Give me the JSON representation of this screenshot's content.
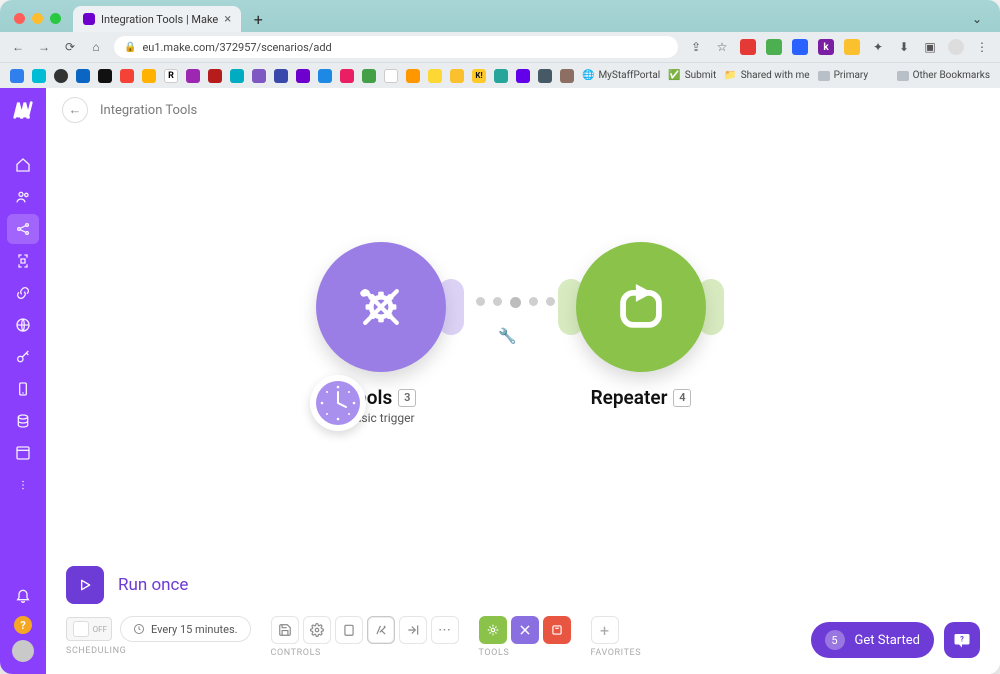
{
  "browser": {
    "tab_title": "Integration Tools | Make",
    "url": "eu1.make.com/372957/scenarios/add",
    "bookmarks": {
      "mystaff": "MyStaffPortal",
      "submit": "Submit",
      "shared": "Shared with me",
      "primary": "Primary",
      "other": "Other Bookmarks"
    }
  },
  "header": {
    "title": "Integration Tools"
  },
  "nodes": {
    "tools": {
      "title": "Tools",
      "badge": "3",
      "subtitle": "Basic trigger"
    },
    "repeater": {
      "title": "Repeater",
      "badge": "4"
    }
  },
  "run": {
    "label": "Run once"
  },
  "scheduling": {
    "label": "SCHEDULING",
    "toggle": "OFF",
    "interval": "Every 15 minutes."
  },
  "controls": {
    "label": "CONTROLS"
  },
  "tools_section": {
    "label": "TOOLS"
  },
  "favorites": {
    "label": "FAVORITES"
  },
  "getstarted": {
    "count": "5",
    "label": "Get Started"
  }
}
